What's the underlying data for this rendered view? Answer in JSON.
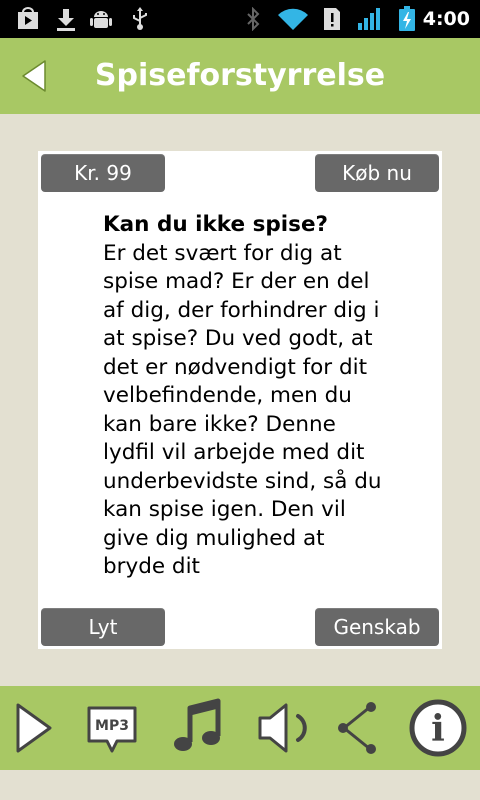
{
  "status_bar": {
    "time": "4:00",
    "icons": [
      "play-store-icon",
      "download-icon",
      "android-debug-icon",
      "usb-icon",
      "bluetooth-icon",
      "wifi-icon",
      "alert-icon",
      "signal-icon",
      "battery-charging-icon"
    ]
  },
  "header": {
    "title": "Spiseforstyrrelse",
    "back_icon": "back-arrow-icon"
  },
  "card": {
    "price_label": "Kr. 99",
    "buy_label": "Køb nu",
    "heading": "Kan du ikke spise?",
    "body": "Er det svært for dig at spise mad? Er der en del af dig, der forhindrer dig i at spise? Du ved godt, at det er nødvendigt for dit velbefindende, men du kan bare ikke? Denne lydfil vil arbejde med dit underbevidste sind, så du kan spise igen. Den vil give dig mulighed at bryde dit",
    "listen_label": "Lyt",
    "restore_label": "Genskab"
  },
  "toolbar": {
    "items": [
      "play-icon",
      "mp3-icon",
      "music-note-icon",
      "speaker-icon",
      "share-icon",
      "info-icon"
    ],
    "mp3_text": "MP3",
    "info_text": "i"
  },
  "colors": {
    "accent_green": "#a8c864",
    "background": "#e3e0d1",
    "button_gray": "#686868",
    "status_blue": "#33b5e5"
  }
}
